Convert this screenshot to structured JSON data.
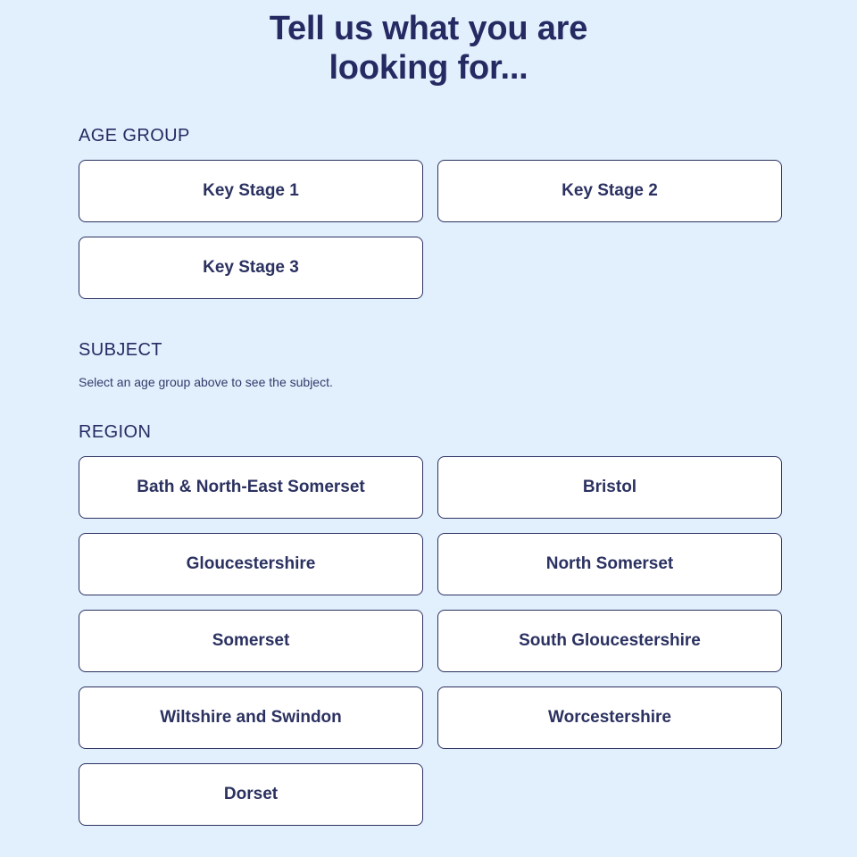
{
  "title": "Tell us what you are\nlooking for...",
  "colors": {
    "background": "#e2f0fd",
    "ink": "#252a62",
    "button_border": "#2b3160",
    "button_fill": "#ffffff"
  },
  "sections": {
    "age_group": {
      "label": "AGE GROUP",
      "options": [
        "Key Stage 1",
        "Key Stage 2",
        "Key Stage 3"
      ]
    },
    "subject": {
      "label": "SUBJECT",
      "helper_text": "Select an age group above to see the subject.",
      "options": []
    },
    "region": {
      "label": "REGION",
      "options": [
        "Bath & North-East Somerset",
        "Bristol",
        "Gloucestershire",
        "North Somerset",
        "Somerset",
        "South Gloucestershire",
        "Wiltshire and Swindon",
        "Worcestershire",
        "Dorset"
      ]
    }
  }
}
